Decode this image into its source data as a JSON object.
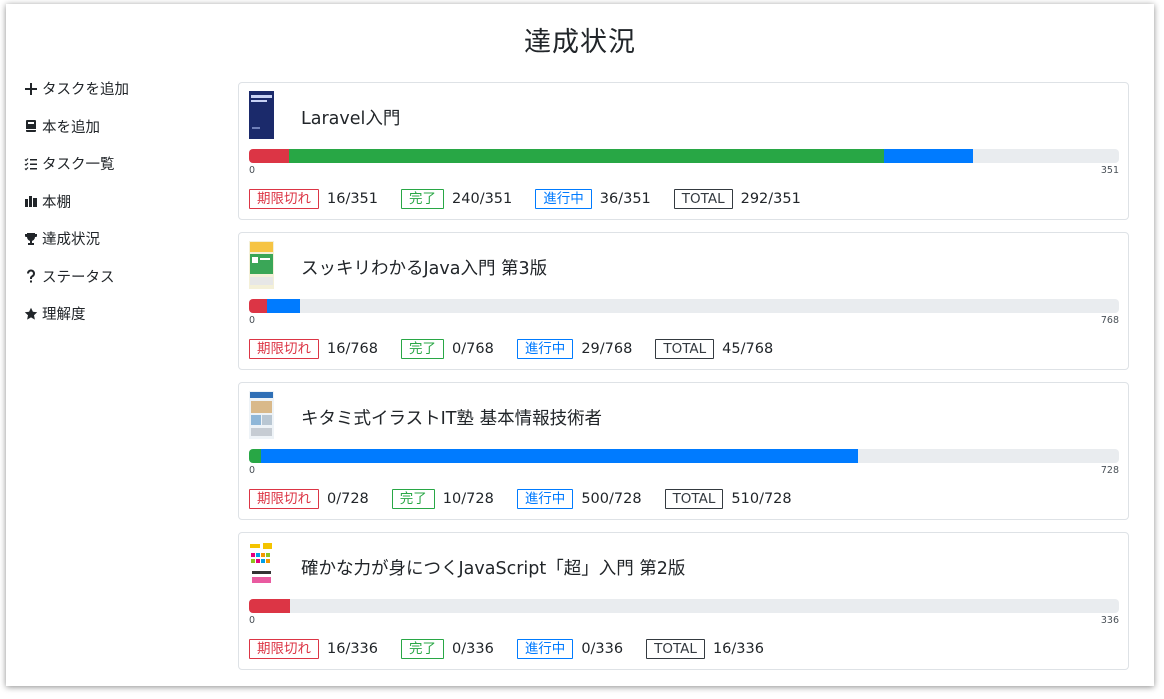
{
  "page": {
    "title": "達成状況"
  },
  "sidebar": {
    "items": [
      {
        "label": "タスクを追加",
        "icon": "plus-icon"
      },
      {
        "label": "本を追加",
        "icon": "book-icon"
      },
      {
        "label": "タスク一覧",
        "icon": "list-check-icon"
      },
      {
        "label": "本棚",
        "icon": "bookshelf-icon"
      },
      {
        "label": "達成状況",
        "icon": "trophy-icon"
      },
      {
        "label": "ステータス",
        "icon": "question-icon"
      },
      {
        "label": "理解度",
        "icon": "star-icon"
      }
    ]
  },
  "labels": {
    "expired": "期限切れ",
    "done": "完了",
    "progress": "進行中",
    "total": "TOTAL"
  },
  "colors": {
    "expired": "#dc3545",
    "done": "#28a745",
    "progress": "#007bff",
    "track": "#e9ecef"
  },
  "books": [
    {
      "title": "Laravel入門",
      "axis_min": "0",
      "axis_max": "351",
      "expired": 16,
      "done": 240,
      "progress": 36,
      "total_pages": 351,
      "expired_text": "16/351",
      "done_text": "240/351",
      "progress_text": "36/351",
      "total_text": "292/351"
    },
    {
      "title": "スッキリわかるJava入門 第3版",
      "axis_min": "0",
      "axis_max": "768",
      "expired": 16,
      "done": 0,
      "progress": 29,
      "total_pages": 768,
      "expired_text": "16/768",
      "done_text": "0/768",
      "progress_text": "29/768",
      "total_text": "45/768"
    },
    {
      "title": "キタミ式イラストIT塾 基本情報技術者",
      "axis_min": "0",
      "axis_max": "728",
      "expired": 0,
      "done": 10,
      "progress": 500,
      "total_pages": 728,
      "expired_text": "0/728",
      "done_text": "10/728",
      "progress_text": "500/728",
      "total_text": "510/728"
    },
    {
      "title": "確かな力が身につくJavaScript「超」入門 第2版",
      "axis_min": "0",
      "axis_max": "336",
      "expired": 16,
      "done": 0,
      "progress": 0,
      "total_pages": 336,
      "expired_text": "16/336",
      "done_text": "0/336",
      "progress_text": "0/336",
      "total_text": "16/336"
    }
  ]
}
